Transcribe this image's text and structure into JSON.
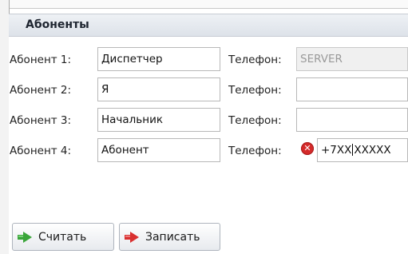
{
  "panel": {
    "title": "Абоненты"
  },
  "subscribers": [
    {
      "label": "Абонент 1:",
      "name": "Диспетчер",
      "phone_label": "Телефон:",
      "phone": "SERVER",
      "phone_disabled": true
    },
    {
      "label": "Абонент 2:",
      "name": "Я",
      "phone_label": "Телефон:",
      "phone": ""
    },
    {
      "label": "Абонент 3:",
      "name": "Начальник",
      "phone_label": "Телефон:",
      "phone": ""
    },
    {
      "label": "Абонент 4:",
      "name": "Абонент",
      "phone_label": "Телефон:",
      "phone_before_caret": "+7XX",
      "phone_after_caret": "XXXXX",
      "phone_error": true
    }
  ],
  "buttons": {
    "read": "Считать",
    "write": "Записать"
  },
  "icons": {
    "read": "arrow-right-green-icon",
    "write": "arrow-right-red-icon",
    "error": "error-x-icon"
  },
  "colors": {
    "read_icon": "#3aa53a",
    "write_icon": "#d93030",
    "error": "#d42a2a"
  }
}
